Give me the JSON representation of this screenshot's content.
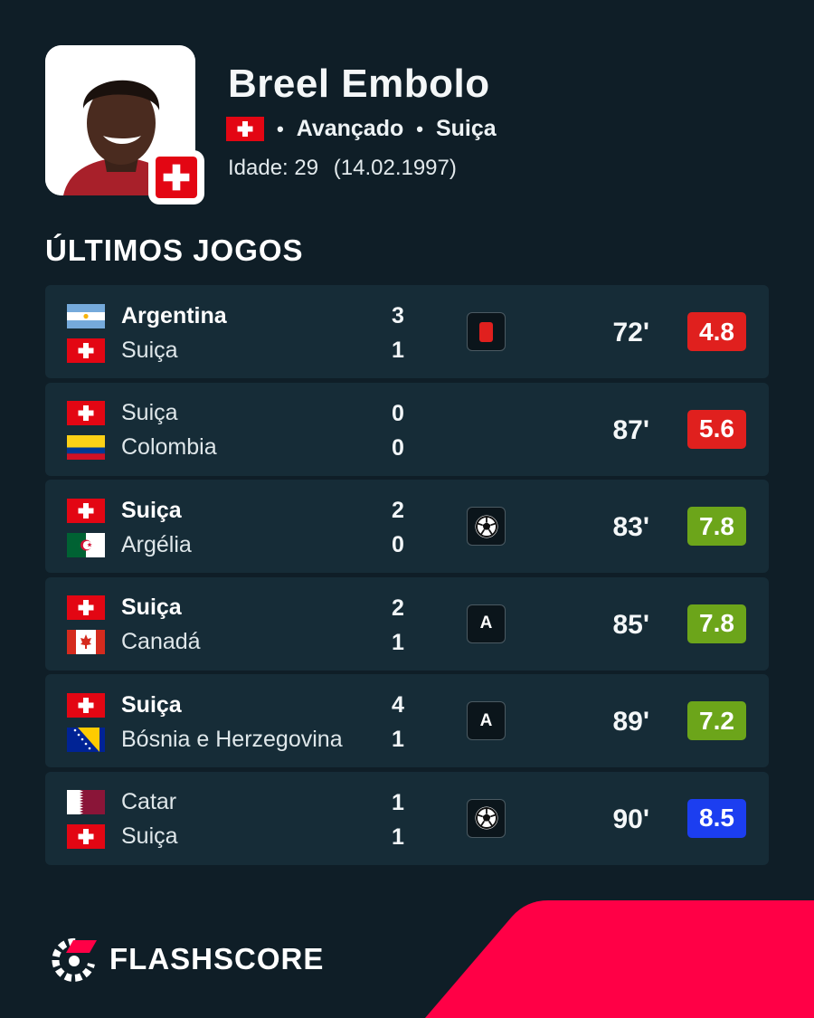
{
  "player": {
    "name": "Breel Embolo",
    "position": "Avançado",
    "nation": "Suiça",
    "age_label": "Idade: 29",
    "birthdate": "(14.02.1997)"
  },
  "section_title": "ÚLTIMOS JOGOS",
  "matches": [
    {
      "home": {
        "name": "Argentina",
        "flag": "argentina-flag",
        "bold": true
      },
      "away": {
        "name": "Suiça",
        "flag": "switzerland-flag",
        "bold": false
      },
      "home_score": "3",
      "away_score": "1",
      "event": "red-card-icon",
      "minutes": "72'",
      "rating": "4.8",
      "rating_color": "#e0201e"
    },
    {
      "home": {
        "name": "Suiça",
        "flag": "switzerland-flag",
        "bold": false
      },
      "away": {
        "name": "Colombia",
        "flag": "colombia-flag",
        "bold": false
      },
      "home_score": "0",
      "away_score": "0",
      "event": "",
      "minutes": "87'",
      "rating": "5.6",
      "rating_color": "#e0201e"
    },
    {
      "home": {
        "name": "Suiça",
        "flag": "switzerland-flag",
        "bold": true
      },
      "away": {
        "name": "Argélia",
        "flag": "algeria-flag",
        "bold": false
      },
      "home_score": "2",
      "away_score": "0",
      "event": "goal-ball-icon",
      "minutes": "83'",
      "rating": "7.8",
      "rating_color": "#6ca51a"
    },
    {
      "home": {
        "name": "Suiça",
        "flag": "switzerland-flag",
        "bold": true
      },
      "away": {
        "name": "Canadá",
        "flag": "canada-flag",
        "bold": false
      },
      "home_score": "2",
      "away_score": "1",
      "event": "assist-icon",
      "event_label": "A",
      "minutes": "85'",
      "rating": "7.8",
      "rating_color": "#6ca51a"
    },
    {
      "home": {
        "name": "Suiça",
        "flag": "switzerland-flag",
        "bold": true
      },
      "away": {
        "name": "Bósnia e Herzegovina",
        "flag": "bosnia-flag",
        "bold": false
      },
      "home_score": "4",
      "away_score": "1",
      "event": "assist-icon",
      "event_label": "A",
      "minutes": "89'",
      "rating": "7.2",
      "rating_color": "#6ca51a"
    },
    {
      "home": {
        "name": "Catar",
        "flag": "qatar-flag",
        "bold": false
      },
      "away": {
        "name": "Suiça",
        "flag": "switzerland-flag",
        "bold": false
      },
      "home_score": "1",
      "away_score": "1",
      "event": "goal-ball-icon",
      "minutes": "90'",
      "rating": "8.5",
      "rating_color": "#1c3ef0"
    }
  ],
  "brand": {
    "name": "FLASHSCORE",
    "accent": "#ff0046"
  },
  "colors": {
    "background": "#0f1e27",
    "row": "#162c37"
  }
}
